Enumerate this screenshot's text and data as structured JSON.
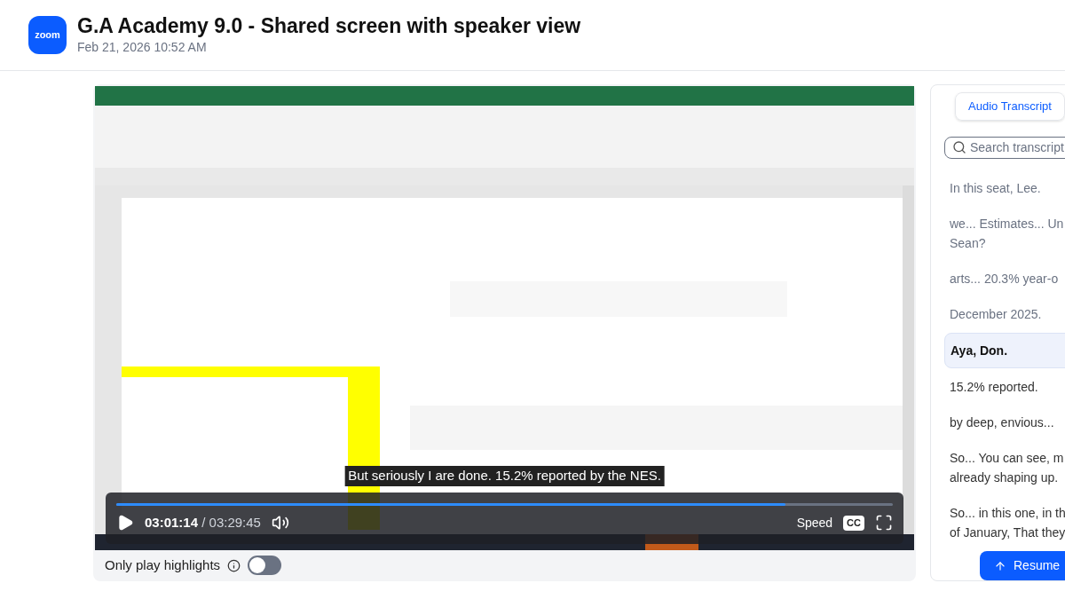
{
  "header": {
    "logo": "zoom",
    "title": "G.A Academy 9.0 - Shared screen with speaker view",
    "date": "Feb 21, 2026 10:52 AM"
  },
  "player": {
    "caption": "But seriously I are done. 15.2% reported by the NES.",
    "progress": {
      "level": 0.862
    },
    "playing": false,
    "current_time": "03:01:14",
    "duration": "/ 03:29:45",
    "speed": "Speed",
    "cc": "CC"
  },
  "highlights": {
    "label": "Only play highlights",
    "on": false
  },
  "transcript": {
    "tab": "Audio Transcript",
    "search": {
      "placeholder": "Search transcript"
    },
    "items": [
      {
        "lines": [
          "In this seat, Lee."
        ],
        "played": true,
        "selected": false
      },
      {
        "lines": [
          "we... Estimates... Un",
          "Sean?"
        ],
        "played": true,
        "selected": false
      },
      {
        "lines": [
          "arts... 20.3% year-o"
        ],
        "played": true,
        "selected": false
      },
      {
        "lines": [
          "December 2025."
        ],
        "played": true,
        "selected": false
      },
      {
        "lines": [
          "Aya, Don."
        ],
        "played": false,
        "selected": true
      },
      {
        "lines": [
          "15.2% reported."
        ],
        "played": false,
        "selected": false
      },
      {
        "lines": [
          "by deep, envious..."
        ],
        "played": false,
        "selected": false
      },
      {
        "lines": [
          "So... You can see, m",
          "already shaping up."
        ],
        "played": false,
        "selected": false
      },
      {
        "lines": [
          "So... in this one, in th",
          "of January, That they"
        ],
        "played": false,
        "selected": false
      }
    ],
    "resume": "Resume"
  }
}
